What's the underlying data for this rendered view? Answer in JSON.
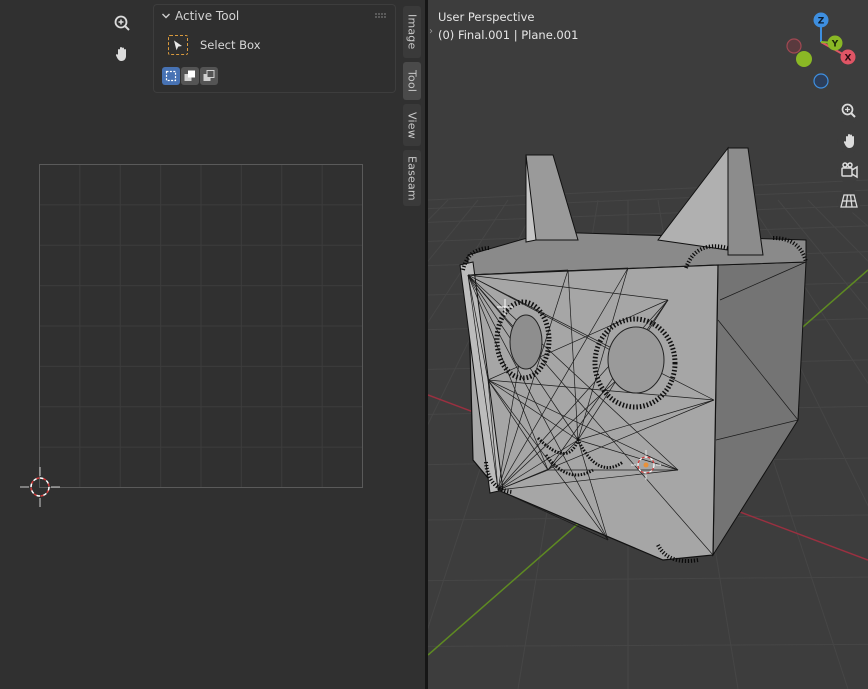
{
  "uv_editor": {
    "nav": {
      "zoom": "zoom-icon",
      "pan": "hand-icon"
    },
    "panel": {
      "title": "Active Tool",
      "tool_name": "Select Box",
      "modes": [
        "set",
        "extend",
        "subtract"
      ],
      "active_mode": "set"
    },
    "sidebar_tabs": [
      {
        "label": "Image",
        "active": false
      },
      {
        "label": "Tool",
        "active": true
      },
      {
        "label": "View",
        "active": false
      },
      {
        "label": "Easeam",
        "active": false
      }
    ]
  },
  "viewport": {
    "title": "User Perspective",
    "subtitle": "(0) Final.001 | Plane.001",
    "gizmo": {
      "x_label": "X",
      "y_label": "Y",
      "z_label": "Z",
      "x_color": "#e05565",
      "y_color": "#8ab825",
      "z_color": "#3e8fe0"
    },
    "nav_buttons": [
      "zoom-icon",
      "hand-icon",
      "camera-icon",
      "grid-icon"
    ]
  },
  "colors": {
    "active_tab": "#4a4a4a",
    "accent": "#4772b3",
    "select_outline": "#d99a3d"
  }
}
